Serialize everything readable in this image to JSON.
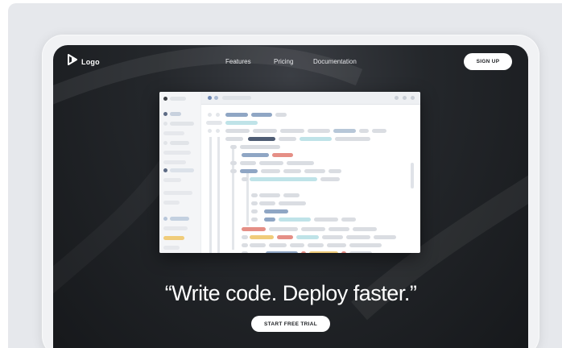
{
  "nav": {
    "logo_text": "Logo",
    "links": [
      "Features",
      "Pricing",
      "Documentation"
    ],
    "signup_label": "SIGN UP"
  },
  "hero": {
    "headline": "“Write code. Deploy faster.”",
    "cta_label": "START FREE TRIAL"
  },
  "icons": {
    "logo": "logo-mark-icon"
  },
  "colors": {
    "background_dark": "#1a1c1f",
    "button_bg": "#ffffff",
    "button_text": "#1c1e22",
    "code_blue": "#8fa6c4",
    "code_teal": "#bfe3e8",
    "code_red": "#e58f86",
    "code_yellow": "#f0cc7a",
    "code_gray": "#dadde2"
  }
}
